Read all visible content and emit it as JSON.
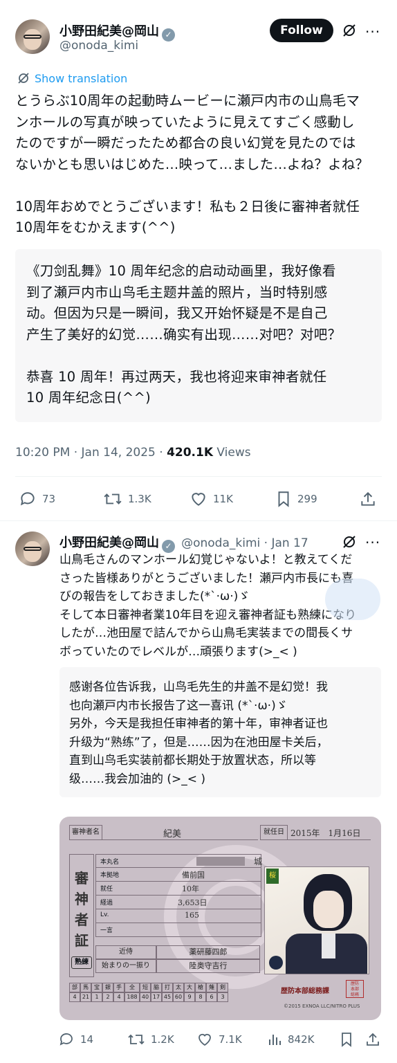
{
  "tweet": {
    "author_name": "小野田紀美@岡山",
    "author_handle": "@onoda_kimi",
    "follow_label": "Follow",
    "show_translation": "Show translation",
    "text": "とうらぶ10周年の起動時ムービーに瀬戸内市の山鳥毛マ\nンホールの写真が映っていたように見えてすごく感動し\nたのですが一瞬だったため都合の良い幻覚を見たのでは\nないかとも思いはじめた…映って…ました…よね？よね？\n\n10周年おめでとうございます！私も２日後に審神者就任\n10周年をむかえます(^^)",
    "translation": "《刀剑乱舞》10 周年纪念的启动动画里，我好像看\n到了瀬戸内市山鸟毛主题井盖的照片，当时特别感\n动。但因为只是一瞬间，我又开始怀疑是不是自己\n产生了美好的幻觉……确实有出现……对吧？对吧？\n\n恭喜 10 周年！再过两天，我也将迎来审神者就任\n10 周年纪念日(^^)",
    "time": "10:20 PM · Jan 14, 2025 · ",
    "views_count": "420.1K",
    "views_label": " Views",
    "replies": "73",
    "reposts": "1.3K",
    "likes": "11K",
    "bookmarks": "299"
  },
  "reply": {
    "author_name": "小野田紀美@岡山",
    "author_handle": "@onoda_kimi · Jan 17",
    "text": "山鳥毛さんのマンホール幻覚じゃないよ！と教えてくだ\nさった皆様ありがとうございました！瀬戸内市長にも喜\nびの報告をしておきました(*ˋ·ω·)ゞ\nそして本日審神者業10年目を迎え審神者証も熟練になり\nしたが…池田屋で詰んでから山鳥毛実装までの間長くサ\nボっていたのでレベルが…頑張ります(>_< )",
    "translation": "感谢各位告诉我，山鸟毛先生的井盖不是幻觉！我\n也向瀬戸内市长报告了这一喜讯 (*ˋ·ω·)ゞ\n另外，今天是我担任审神者的第十年，审神者证也\n升级为“熟练”了，但是……因为在池田屋卡关后，\n直到山鸟毛实装前都长期处于放置状态，所以等\n级……我会加油的 (>_< )",
    "replies": "14",
    "reposts": "1.2K",
    "likes": "7.1K",
    "views": "842K"
  },
  "card": {
    "label_name": "審神者名",
    "name": "紀美",
    "label_date": "就任日",
    "date": "2015年　1月16日",
    "vertical_title": [
      "審",
      "神",
      "者",
      "証"
    ],
    "rank": "熟練",
    "rows": [
      {
        "label": "本丸名",
        "value": "",
        "suffix": "城"
      },
      {
        "label": "本拠地",
        "value": "備前国"
      },
      {
        "label": "就任",
        "value": "10年"
      },
      {
        "label": "経過",
        "value": "3,653日"
      },
      {
        "label": "Lv.",
        "value": "165"
      },
      {
        "label": "一言",
        "value": ""
      }
    ],
    "kinji_label": "近侍",
    "kinji": "薬研藤四郎",
    "first_label": "始まりの一振り",
    "first": "陸奥守吉行",
    "stat_heads": [
      "部",
      "馬",
      "宝",
      "銀",
      "手",
      "全",
      "短",
      "脇",
      "打",
      "太",
      "大",
      "槍",
      "薙",
      "剣"
    ],
    "stat_vals": [
      "4",
      "21",
      "1",
      "2",
      "4",
      "188",
      "40",
      "17",
      "45",
      "60",
      "9",
      "8",
      "6",
      "3"
    ],
    "office": "歴防本部総務課",
    "copyright": "©2015 EXNOA LLC/NITRO PLUS",
    "seal": "歴防本部総務課"
  }
}
